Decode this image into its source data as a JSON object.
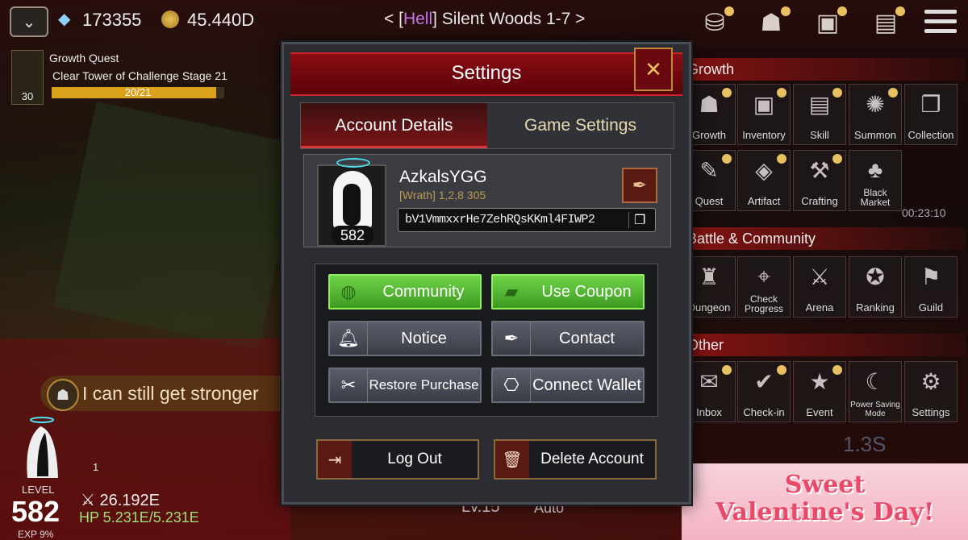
{
  "hud": {
    "collapse_icon": "chevron-double-down-icon",
    "gems": "173355",
    "gold": "45.440D",
    "stage_prefix": "< [",
    "stage_hell": "Hell",
    "stage_suffix": "] Silent Woods 1-7 >"
  },
  "quest": {
    "title": "Growth Quest",
    "description": "Clear Tower of Challenge Stage 21",
    "progress_text": "20/21",
    "progress_fraction": 0.952,
    "level": "30"
  },
  "speech": {
    "text": "I can still get stronger"
  },
  "player": {
    "level_label": "LEVEL",
    "level": "582",
    "exp_label": "EXP 9%",
    "power": "26.192E",
    "hp": "HP 5.231E/5.231E",
    "minion_count": "1"
  },
  "battle": {
    "level": "Lv.15",
    "auto": "Auto",
    "timer": "00:23:10",
    "cooldown": "1.3S"
  },
  "dialog": {
    "title": "Settings",
    "tabs": [
      "Account Details",
      "Game Settings"
    ],
    "profile": {
      "username": "AzkalsYGG",
      "guild": "[Wrath] 1,2,8 305",
      "level": "582",
      "wallet_address": "bV1VmmxxrHe7ZehRQsKKml4FIWP2"
    },
    "buttons": {
      "community": "Community",
      "use_coupon": "Use Coupon",
      "notice": "Notice",
      "contact": "Contact",
      "restore_purchase": "Restore Purchase",
      "connect_wallet": "Connect Wallet",
      "log_out": "Log Out",
      "delete_account": "Delete Account"
    }
  },
  "side_menu": {
    "growth_title": "Growth",
    "battle_title": "Battle & Community",
    "other_title": "Other",
    "growth": [
      "Growth",
      "Inventory",
      "Skill",
      "Summon",
      "Collection",
      "Quest",
      "Artifact",
      "Crafting",
      "Black Market"
    ],
    "battle": [
      "Dungeon",
      "Check Progress",
      "Arena",
      "Ranking",
      "Guild"
    ],
    "other": [
      "Inbox",
      "Check-in",
      "Event",
      "Power Saving Mode",
      "Settings"
    ]
  },
  "banner": {
    "line1": "Sweet",
    "line2": "Valentine's Day!"
  },
  "colors": {
    "dialog_header": "#8a0d14",
    "green_button": "#5cc03a",
    "accent_gold": "#e8c060",
    "hell_purple": "#c47ae8"
  }
}
